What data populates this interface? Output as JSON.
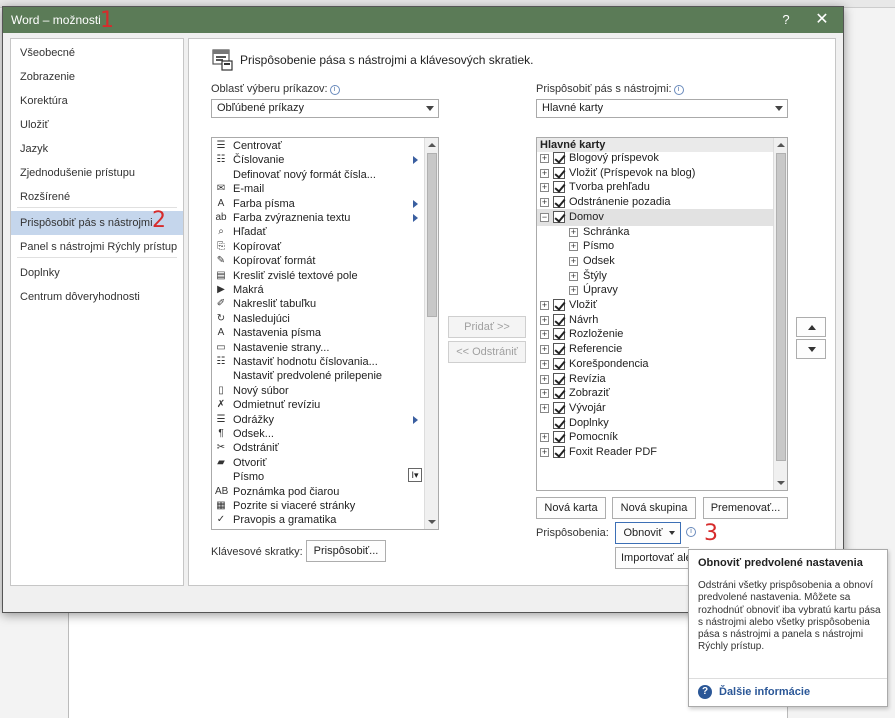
{
  "window": {
    "title": "Word – možnosti",
    "help_label": "?",
    "close_label": "✕"
  },
  "markers": [
    "1",
    "2",
    "3"
  ],
  "nav": {
    "items": [
      {
        "label": "Všeobecné"
      },
      {
        "label": "Zobrazenie"
      },
      {
        "label": "Korektúra"
      },
      {
        "label": "Uložiť"
      },
      {
        "label": "Jazyk"
      },
      {
        "label": "Zjednodušenie prístupu"
      },
      {
        "label": "Rozšírené"
      },
      {
        "label": "Prispôsobiť pás s nástrojmi",
        "active": true
      },
      {
        "label": "Panel s nástrojmi Rýchly prístup"
      },
      {
        "label": "Doplnky"
      },
      {
        "label": "Centrum dôveryhodnosti"
      }
    ]
  },
  "main": {
    "heading": "Prispôsobenie pása s nástrojmi a klávesových skratiek.",
    "commands_label": "Oblasť výberu príkazov:",
    "commands_value": "Obľúbené príkazy",
    "ribbon_label": "Prispôsobiť pás s nástrojmi:",
    "ribbon_value": "Hlavné karty",
    "commands": [
      {
        "icon": "☰",
        "label": "Centrovať",
        "sub": false
      },
      {
        "icon": "☷",
        "label": "Číslovanie",
        "sub": true
      },
      {
        "icon": "",
        "label": "Definovať nový formát čísla...",
        "sub": false
      },
      {
        "icon": "✉",
        "label": "E-mail",
        "sub": false
      },
      {
        "icon": "A",
        "label": "Farba písma",
        "sub": true
      },
      {
        "icon": "ab",
        "label": "Farba zvýraznenia textu",
        "sub": true
      },
      {
        "icon": "⌕",
        "label": "Hľadať",
        "sub": false
      },
      {
        "icon": "⎘",
        "label": "Kopírovať",
        "sub": false
      },
      {
        "icon": "✎",
        "label": "Kopírovať formát",
        "sub": false
      },
      {
        "icon": "▤",
        "label": "Kresliť zvislé textové pole",
        "sub": false
      },
      {
        "icon": "▶",
        "label": "Makrá",
        "sub": false
      },
      {
        "icon": "✐",
        "label": "Nakresliť tabuľku",
        "sub": false
      },
      {
        "icon": "↻",
        "label": "Nasledujúci",
        "sub": false
      },
      {
        "icon": "A",
        "label": "Nastavenia písma",
        "sub": false
      },
      {
        "icon": "▭",
        "label": "Nastavenie strany...",
        "sub": false
      },
      {
        "icon": "☷",
        "label": "Nastaviť hodnotu číslovania...",
        "sub": false
      },
      {
        "icon": "",
        "label": "Nastaviť predvolené prilepenie",
        "sub": false
      },
      {
        "icon": "▯",
        "label": "Nový súbor",
        "sub": false
      },
      {
        "icon": "✗",
        "label": "Odmietnuť revíziu",
        "sub": false
      },
      {
        "icon": "☰",
        "label": "Odrážky",
        "sub": true
      },
      {
        "icon": "¶",
        "label": "Odsek...",
        "sub": false
      },
      {
        "icon": "✂",
        "label": "Odstrániť",
        "sub": false
      },
      {
        "icon": "▰",
        "label": "Otvoriť",
        "sub": false
      },
      {
        "icon": "",
        "label": "Písmo",
        "sub": false
      },
      {
        "icon": "AB",
        "label": "Poznámka pod čiarou",
        "sub": false
      },
      {
        "icon": "▦",
        "label": "Pozrite si viaceré stránky",
        "sub": false
      },
      {
        "icon": "✓",
        "label": "Pravopis a gramatika",
        "sub": false
      }
    ],
    "add_button": "Pridať >>",
    "remove_button": "<< Odstrániť",
    "tree_header": "Hlavné karty",
    "tree": [
      {
        "label": "Blogový príspevok",
        "level": 0,
        "pm": "+",
        "check": true
      },
      {
        "label": "Vložiť (Príspevok na blog)",
        "level": 0,
        "pm": "+",
        "check": true
      },
      {
        "label": "Tvorba prehľadu",
        "level": 0,
        "pm": "+",
        "check": true
      },
      {
        "label": "Odstránenie pozadia",
        "level": 0,
        "pm": "+",
        "check": true
      },
      {
        "label": "Domov",
        "level": 0,
        "pm": "−",
        "check": true,
        "selected": true
      },
      {
        "label": "Schránka",
        "level": 1,
        "pm": "+",
        "check": false
      },
      {
        "label": "Písmo",
        "level": 1,
        "pm": "+",
        "check": false
      },
      {
        "label": "Odsek",
        "level": 1,
        "pm": "+",
        "check": false
      },
      {
        "label": "Štýly",
        "level": 1,
        "pm": "+",
        "check": false
      },
      {
        "label": "Úpravy",
        "level": 1,
        "pm": "+",
        "check": false
      },
      {
        "label": "Vložiť",
        "level": 0,
        "pm": "+",
        "check": true
      },
      {
        "label": "Návrh",
        "level": 0,
        "pm": "+",
        "check": true
      },
      {
        "label": "Rozloženie",
        "level": 0,
        "pm": "+",
        "check": true
      },
      {
        "label": "Referencie",
        "level": 0,
        "pm": "+",
        "check": true
      },
      {
        "label": "Korešpondencia",
        "level": 0,
        "pm": "+",
        "check": true
      },
      {
        "label": "Revízia",
        "level": 0,
        "pm": "+",
        "check": true
      },
      {
        "label": "Zobraziť",
        "level": 0,
        "pm": "+",
        "check": true
      },
      {
        "label": "Vývojár",
        "level": 0,
        "pm": "+",
        "check": true
      },
      {
        "label": "Doplnky",
        "level": 0,
        "pm": "",
        "check": true
      },
      {
        "label": "Pomocník",
        "level": 0,
        "pm": "+",
        "check": true
      },
      {
        "label": "Foxit Reader PDF",
        "level": 0,
        "pm": "+",
        "check": true
      }
    ],
    "new_tab_button": "Nová karta",
    "new_group_button": "Nová skupina",
    "rename_button": "Premenovať...",
    "customizations_label": "Prispôsobenia:",
    "reset_button": "Obnoviť",
    "import_button": "Importovať alebo exportovať",
    "shortcuts_label": "Klávesové skratky:",
    "customize_button": "Prispôsobiť..."
  },
  "tooltip": {
    "title": "Obnoviť predvolené nastavenia",
    "body": "Odstráni všetky prispôsobenia a obnoví predvolené nastavenia. Môžete sa rozhodnúť obnoviť iba vybratú kartu pása s nástrojmi alebo všetky prispôsobenia pása s nástrojmi a panela s nástrojmi Rýchly prístup.",
    "help_icon": "?",
    "link": "Ďalšie informácie"
  },
  "colors": {
    "titlebar": "#5b7b57",
    "nav_active": "#c5d6ec",
    "marker": "#d62b2b",
    "link": "#2b5797"
  }
}
